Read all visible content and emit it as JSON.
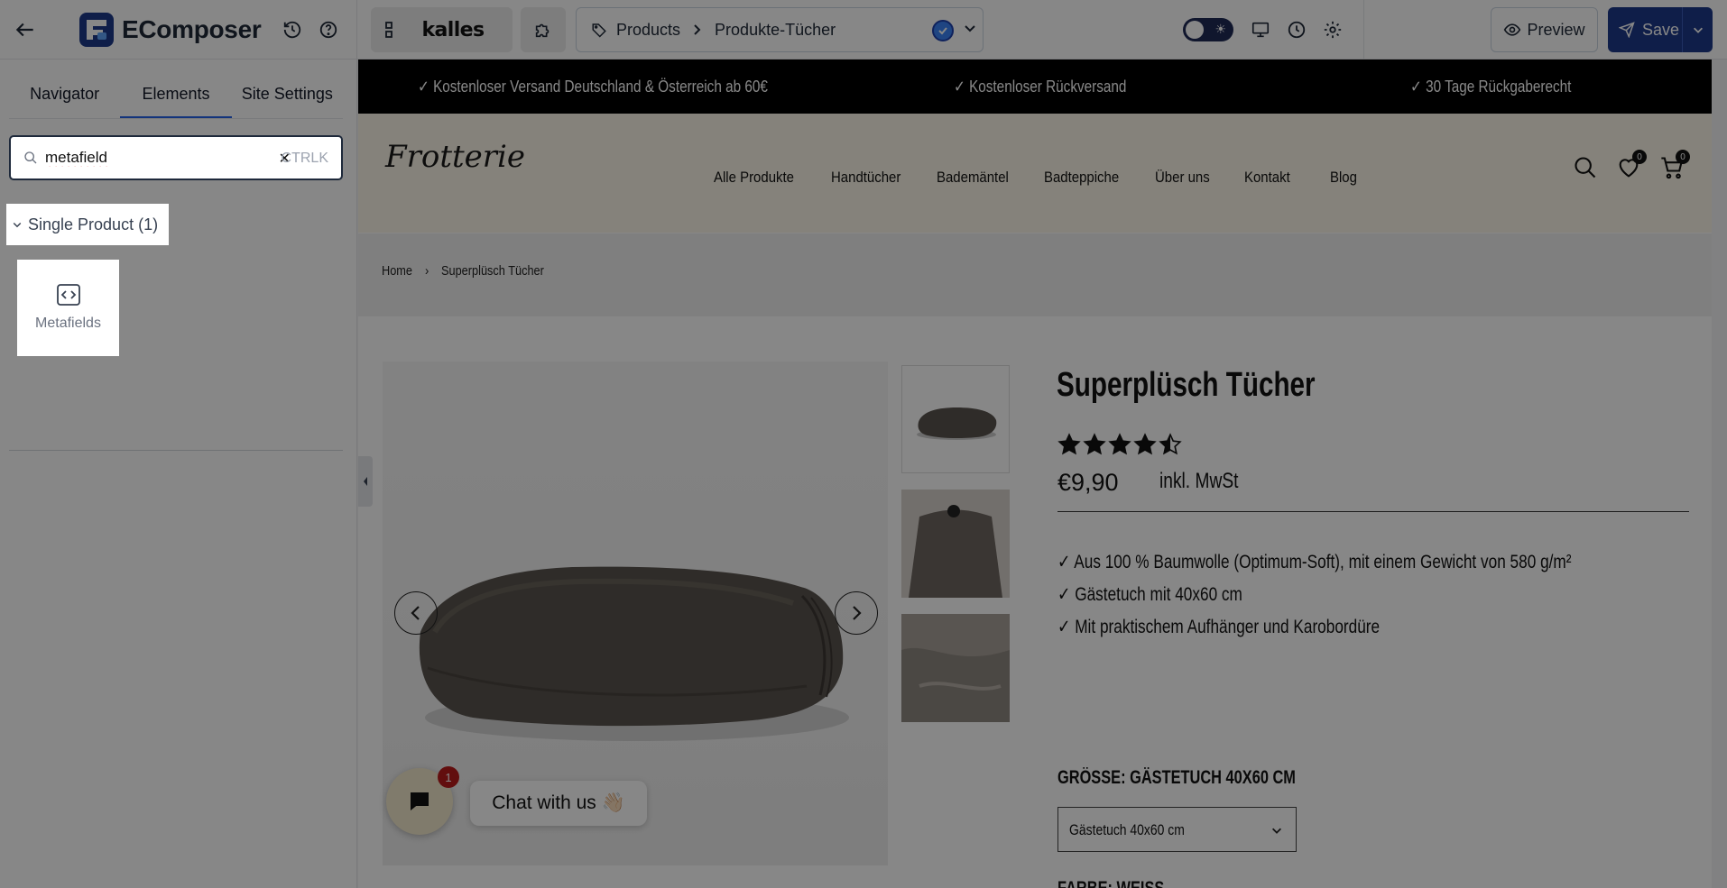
{
  "app": {
    "logo_text": "EComposer",
    "theme_name": "kalles",
    "breadcrumb": {
      "type": "Products",
      "page": "Produkte-Tücher"
    },
    "preview_label": "Preview",
    "save_label": "Save"
  },
  "sidebar": {
    "tabs": [
      "Navigator",
      "Elements",
      "Site Settings"
    ],
    "active_tab": "Elements",
    "search": {
      "value": "metafield",
      "shortcut": "CTRLK"
    },
    "group": {
      "label": "Single Product (1)"
    },
    "elements": [
      {
        "label": "Metafields",
        "icon": "code-icon"
      }
    ]
  },
  "store": {
    "announcements": [
      "✓ Kostenloser Versand Deutschland & Österreich ab 60€",
      "✓ Kostenloser Rückversand",
      "✓ 30 Tage Rückgaberecht"
    ],
    "logo": "Frotterie",
    "nav": [
      "Alle Produkte",
      "Handtücher",
      "Bademäntel",
      "Badteppiche",
      "Über uns",
      "Kontakt",
      "Blog"
    ],
    "wishlist_count": "0",
    "cart_count": "0",
    "breadcrumb": {
      "home": "Home",
      "sep": "›",
      "current": "Superplüsch Tücher"
    },
    "product": {
      "title": "Superplüsch Tücher",
      "rating": 4.5,
      "price": "€9,90",
      "tax_note": "inkl. MwSt",
      "features": [
        "✓ Aus 100 % Baumwolle (Optimum-Soft), mit einem Gewicht von 580 g/m²",
        "✓ Gästetuch mit 40x60 cm",
        "✓ Mit praktischem Aufhänger und Karobordüre"
      ],
      "size_label": "GRÖSSE:  GÄSTETUCH 40X60 CM",
      "size_value": "Gästetuch 40x60 cm",
      "color_label": "FARBE:  WEISS"
    },
    "chat": {
      "label": "Chat with us 👋🏻",
      "badge": "1"
    }
  }
}
